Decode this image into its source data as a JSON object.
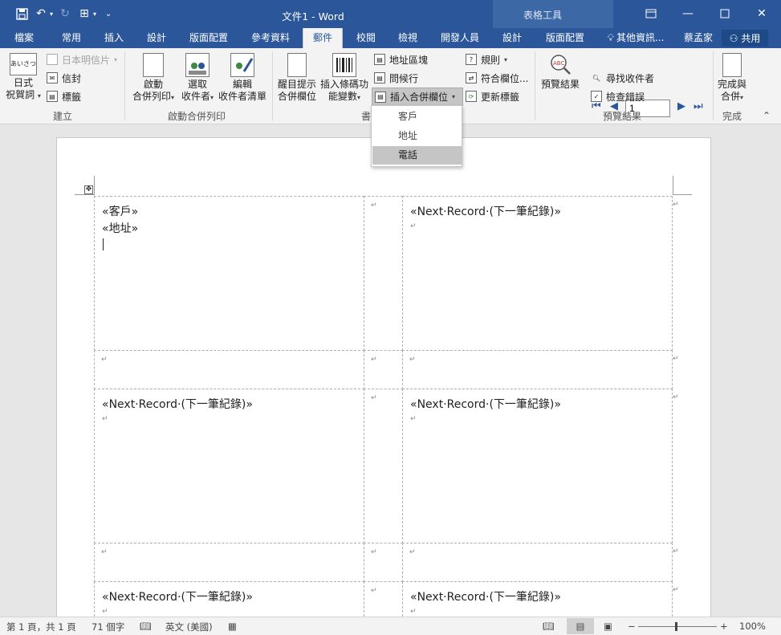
{
  "window": {
    "title": "文件1 - Word",
    "contextual_tools": "表格工具"
  },
  "tabs": [
    "檔案",
    "常用",
    "插入",
    "設計",
    "版面配置",
    "參考資料",
    "郵件",
    "校閱",
    "檢視",
    "開發人員",
    "設計",
    "版面配置"
  ],
  "tab_active": "郵件",
  "tell_me": "其他資訊...",
  "user_name": "蔡孟家",
  "share_label": "共用",
  "ribbon": {
    "create": {
      "greeting_label_1": "日式",
      "greeting_label_2": "祝賀詞",
      "japanese_postcard": "日本明信片",
      "envelopes": "信封",
      "labels": "標籤",
      "group": "建立"
    },
    "start_merge": {
      "start_1": "啟動",
      "start_2": "合併列印",
      "select_1": "選取",
      "select_2": "收件者",
      "edit_1": "編輯",
      "edit_2": "收件者清單",
      "group": "啟動合併列印"
    },
    "write_insert": {
      "highlight_1": "醒目提示",
      "highlight_2": "合併欄位",
      "barcode_1": "插入條碼功",
      "barcode_2": "能變數",
      "address_block": "地址區塊",
      "greeting_line": "問候行",
      "insert_merge_field": "插入合併欄位",
      "rules": "規則",
      "match_fields": "符合欄位...",
      "update_labels": "更新標籤",
      "group_partial": "書"
    },
    "preview": {
      "preview_results": "預覽結果",
      "record_value": "1",
      "find_recipient": "尋找收件者",
      "check_errors": "檢查錯誤",
      "group": "預覽結果"
    },
    "finish": {
      "finish_1": "完成與",
      "finish_2": "合併",
      "group": "完成"
    }
  },
  "merge_field_menu": {
    "items": [
      "客戶",
      "地址",
      "電話"
    ],
    "highlighted": "電話"
  },
  "document": {
    "cell_1_line_1": "«客戶»",
    "cell_1_line_2": "«地址»",
    "next_record": "«Next·Record·(下一筆紀錄)»"
  },
  "status": {
    "page": "第 1 頁，共 1 頁",
    "words": "71 個字",
    "language": "英文 (美國)",
    "zoom": "100%"
  },
  "colors": {
    "title_bar": "#2b579a",
    "ribbon": "#f3f3f3",
    "menu_highlight": "#c5c5c5"
  }
}
